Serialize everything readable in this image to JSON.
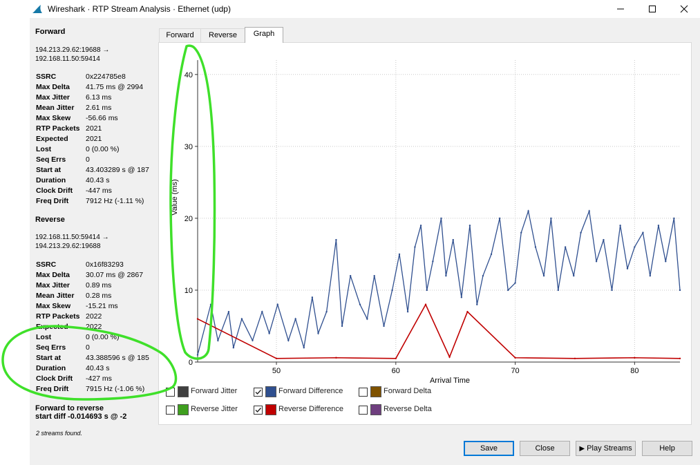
{
  "window": {
    "title": "Wireshark · RTP Stream Analysis · Ethernet (udp)"
  },
  "tabs": [
    "Forward",
    "Reverse",
    "Graph"
  ],
  "active_tab": "Graph",
  "forward": {
    "heading": "Forward",
    "addr_line1": "194.213.29.62:19688 →",
    "addr_line2": "192.168.11.50:59414",
    "stats": [
      {
        "k": "SSRC",
        "v": "0x224785e8"
      },
      {
        "k": "Max Delta",
        "v": "41.75 ms @ 2994"
      },
      {
        "k": "Max Jitter",
        "v": "6.13 ms"
      },
      {
        "k": "Mean Jitter",
        "v": "2.61 ms"
      },
      {
        "k": "Max Skew",
        "v": "-56.66 ms"
      },
      {
        "k": "RTP Packets",
        "v": "2021"
      },
      {
        "k": "Expected",
        "v": "2021"
      },
      {
        "k": "Lost",
        "v": "0 (0.00 %)"
      },
      {
        "k": "Seq Errs",
        "v": "0"
      },
      {
        "k": "Start at",
        "v": "43.403289 s @ 187"
      },
      {
        "k": "Duration",
        "v": "40.43 s"
      },
      {
        "k": "Clock Drift",
        "v": "-447 ms"
      },
      {
        "k": "Freq Drift",
        "v": "7912 Hz (-1.11 %)"
      }
    ]
  },
  "reverse": {
    "heading": "Reverse",
    "addr_line1": "192.168.11.50:59414 →",
    "addr_line2": "194.213.29.62:19688",
    "stats": [
      {
        "k": "SSRC",
        "v": "0x16f83293"
      },
      {
        "k": "Max Delta",
        "v": "30.07 ms @ 2867"
      },
      {
        "k": "Max Jitter",
        "v": "0.89 ms"
      },
      {
        "k": "Mean Jitter",
        "v": "0.28 ms"
      },
      {
        "k": "Max Skew",
        "v": "-15.21 ms"
      },
      {
        "k": "RTP Packets",
        "v": "2022"
      },
      {
        "k": "Expected",
        "v": "2022"
      },
      {
        "k": "Lost",
        "v": "0 (0.00 %)"
      },
      {
        "k": "Seq Errs",
        "v": "0"
      },
      {
        "k": "Start at",
        "v": "43.388596 s @ 185"
      },
      {
        "k": "Duration",
        "v": "40.43 s"
      },
      {
        "k": "Clock Drift",
        "v": "-427 ms"
      },
      {
        "k": "Freq Drift",
        "v": "7915 Hz (-1.06 %)"
      }
    ]
  },
  "diff_line1": "Forward to reverse",
  "diff_line2": "start diff -0.014693 s @ -2",
  "streams_found": "2 streams found.",
  "legend": [
    {
      "label": "Forward Jitter",
      "color": "#404040",
      "checked": false
    },
    {
      "label": "Forward Difference",
      "color": "#2f4f8f",
      "checked": true
    },
    {
      "label": "Forward Delta",
      "color": "#7f5200",
      "checked": false
    },
    {
      "label": "Reverse Jitter",
      "color": "#3f9f1f",
      "checked": false
    },
    {
      "label": "Reverse Difference",
      "color": "#c00000",
      "checked": true
    },
    {
      "label": "Reverse Delta",
      "color": "#6f3f7f",
      "checked": false
    }
  ],
  "buttons": {
    "save": "Save",
    "close": "Close",
    "play": "Play Streams",
    "help": "Help"
  },
  "chart_data": {
    "type": "line",
    "xlabel": "Arrival Time",
    "ylabel": "Value (ms)",
    "xlim": [
      43.4,
      83.8
    ],
    "ylim": [
      0,
      42
    ],
    "xticks": [
      50,
      60,
      70,
      80
    ],
    "yticks": [
      0,
      10,
      20,
      30,
      40
    ],
    "grid": true,
    "series": [
      {
        "name": "Forward Difference",
        "color": "#2f4f8f",
        "x": [
          43.4,
          44.5,
          45.1,
          46.0,
          46.4,
          47.1,
          48.0,
          48.8,
          49.4,
          50.1,
          51.0,
          51.6,
          52.3,
          53.0,
          53.5,
          54.2,
          55.0,
          55.5,
          56.2,
          57.0,
          57.6,
          58.2,
          59.0,
          59.7,
          60.3,
          61.0,
          61.6,
          62.1,
          62.6,
          63.1,
          63.8,
          64.2,
          64.8,
          65.5,
          66.2,
          66.8,
          67.3,
          68.0,
          68.7,
          69.4,
          70.0,
          70.5,
          71.1,
          71.7,
          72.4,
          73.0,
          73.6,
          74.2,
          74.9,
          75.5,
          76.2,
          76.8,
          77.4,
          78.1,
          78.8,
          79.4,
          80.0,
          80.7,
          81.3,
          82.0,
          82.6,
          83.3,
          83.8
        ],
        "y": [
          1,
          8,
          3,
          7,
          2,
          6,
          3,
          7,
          4,
          8,
          3,
          6,
          2,
          9,
          4,
          7,
          17,
          5,
          12,
          8,
          6,
          12,
          5,
          10,
          15,
          7,
          16,
          19,
          10,
          14,
          20,
          12,
          17,
          9,
          19,
          8,
          12,
          15,
          20,
          10,
          11,
          18,
          21,
          16,
          12,
          20,
          10,
          16,
          12,
          18,
          21,
          14,
          17,
          10,
          19,
          13,
          16,
          18,
          12,
          19,
          14,
          20,
          10
        ]
      },
      {
        "name": "Reverse Difference",
        "color": "#c00000",
        "x": [
          43.4,
          50.0,
          55.0,
          60.0,
          62.5,
          64.5,
          66.0,
          70.0,
          75.0,
          80.0,
          83.8
        ],
        "y": [
          6,
          0.5,
          0.6,
          0.5,
          8,
          0.7,
          7,
          0.6,
          0.5,
          0.6,
          0.5
        ]
      }
    ]
  }
}
